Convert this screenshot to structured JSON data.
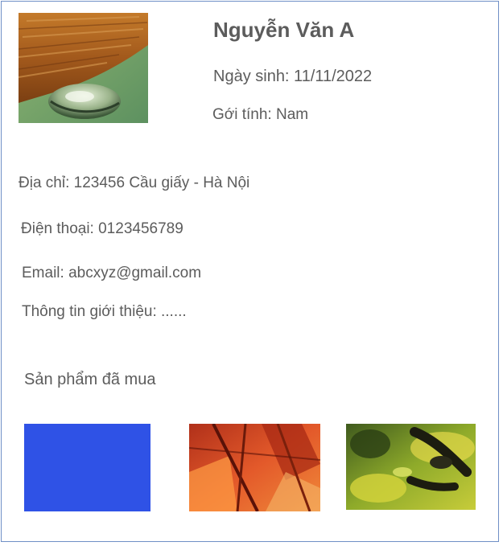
{
  "profile": {
    "name": "Nguyễn Văn A",
    "dob": "Ngày sinh: 11/11/2022",
    "gender": "Gới tính: Nam",
    "avatar": "water-drop-photo"
  },
  "contact": {
    "address": "Địa chỉ: 123456 Cầu giấy - Hà Nội",
    "phone": "Điện thoại: 0123456789",
    "email": "Email: abcxyz@gmail.com",
    "intro": "Thông tin giới thiệu: ......"
  },
  "purchased": {
    "title": "Sản phẩm đã mua",
    "items": [
      {
        "image": "blue-square",
        "color": "#2b4fe3"
      },
      {
        "image": "autumn-leaves-photo",
        "color": "#c8421a"
      },
      {
        "image": "green-insect-photo",
        "color": "#6f8a1e"
      }
    ]
  },
  "colors": {
    "border": "#6f8fc6",
    "text": "#5c5c5c"
  }
}
